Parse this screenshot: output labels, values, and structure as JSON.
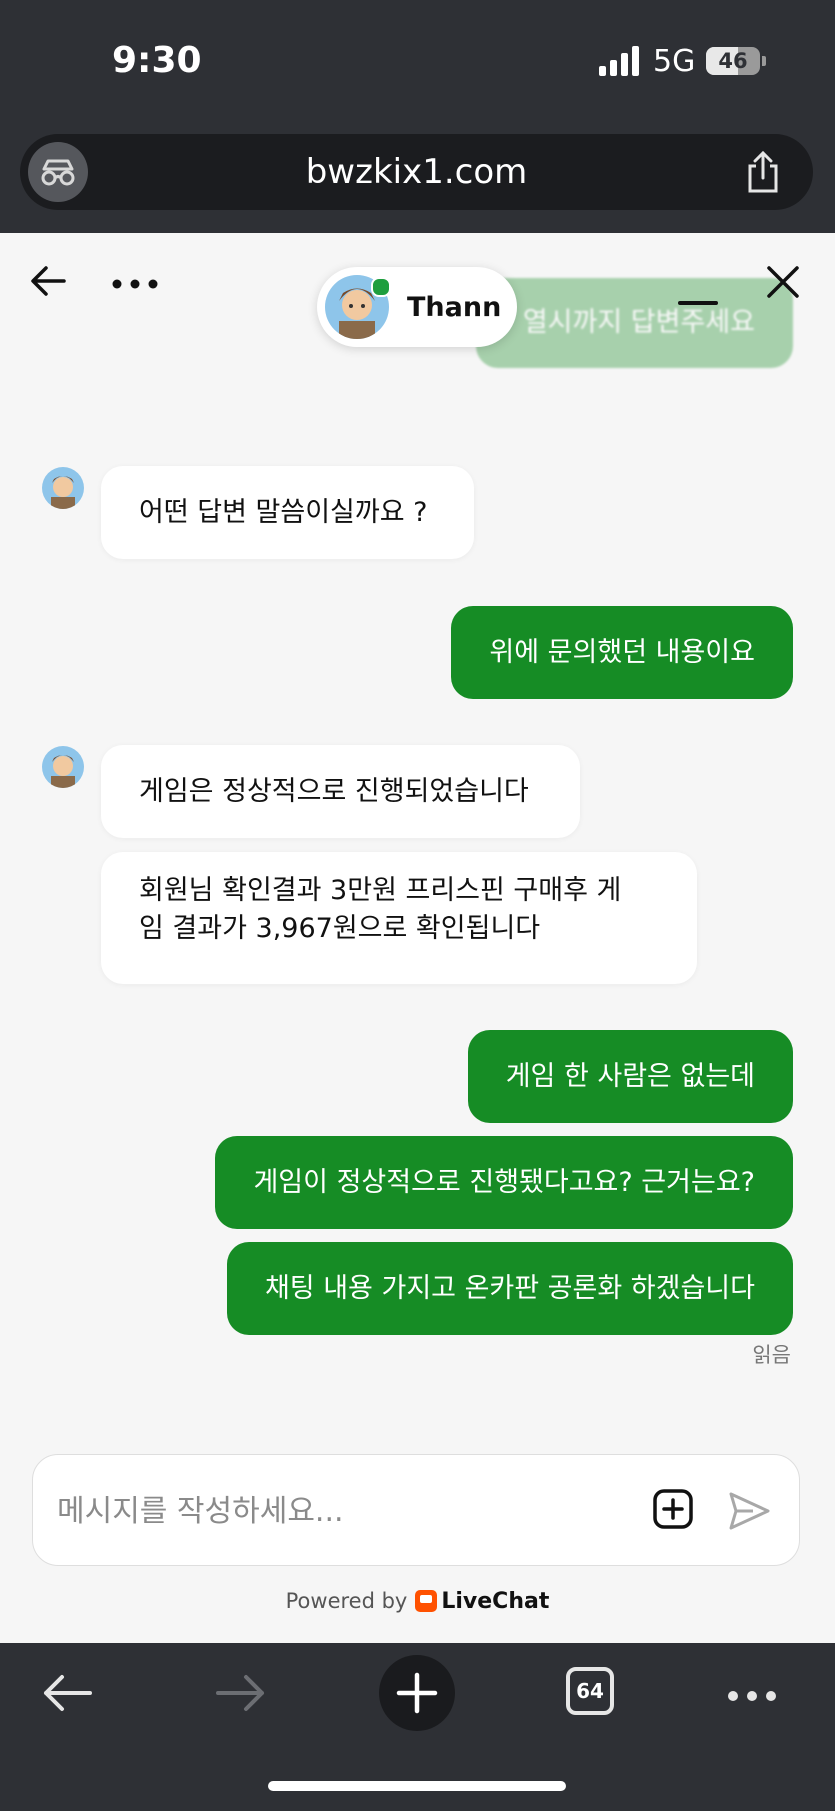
{
  "status_bar": {
    "time": "9:30",
    "network": "5G",
    "battery": "46"
  },
  "browser": {
    "url": "bwzkix1.com",
    "tab_count": "64"
  },
  "chat": {
    "agent_name": "Thann",
    "messages": [
      {
        "from": "visitor",
        "text": "열시까지 답변주세요",
        "faded": true
      },
      {
        "from": "agent",
        "text": "어떤 답변 말씀이실까요 ?"
      },
      {
        "from": "visitor",
        "text": "위에 문의했던 내용이요"
      },
      {
        "from": "agent",
        "text": "게임은 정상적으로 진행되었습니다"
      },
      {
        "from": "agent",
        "text": "회원님 확인결과 3만원 프리스핀 구매후 게임 결과가 3,967원으로 확인됩니다",
        "line1": "회원님 확인결과 3만원 프리스핀 구매후 게",
        "line2": "임 결과가 3,967원으로 확인됩니다"
      },
      {
        "from": "visitor",
        "text": "게임 한 사람은 없는데"
      },
      {
        "from": "visitor",
        "text": "게임이 정상적으로 진행됐다고요? 근거는요?"
      },
      {
        "from": "visitor",
        "text": "채팅 내용 가지고 온카판 공론화 하겠습니다"
      }
    ],
    "read_receipt": "읽음"
  },
  "composer": {
    "placeholder": "메시지를 작성하세요..."
  },
  "footer": {
    "powered_by": "Powered by",
    "brand": "LiveChat"
  },
  "colors": {
    "accent": "#168c25",
    "chrome": "#2e3035",
    "livechat": "#ff5100"
  }
}
